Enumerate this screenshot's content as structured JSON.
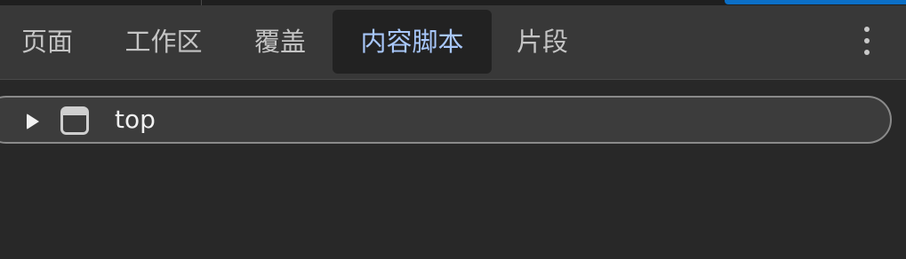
{
  "tabs": [
    {
      "label": "页面",
      "active": false
    },
    {
      "label": "工作区",
      "active": false
    },
    {
      "label": "覆盖",
      "active": false
    },
    {
      "label": "内容脚本",
      "active": true
    },
    {
      "label": "片段",
      "active": false
    }
  ],
  "more_menu": {
    "icon": "more-vertical-icon"
  },
  "tree": {
    "items": [
      {
        "label": "top",
        "expanded": false,
        "icon": "frame-icon"
      }
    ]
  },
  "colors": {
    "active_tab_text": "#a8c7fa",
    "accent": "#0b6fc7"
  }
}
